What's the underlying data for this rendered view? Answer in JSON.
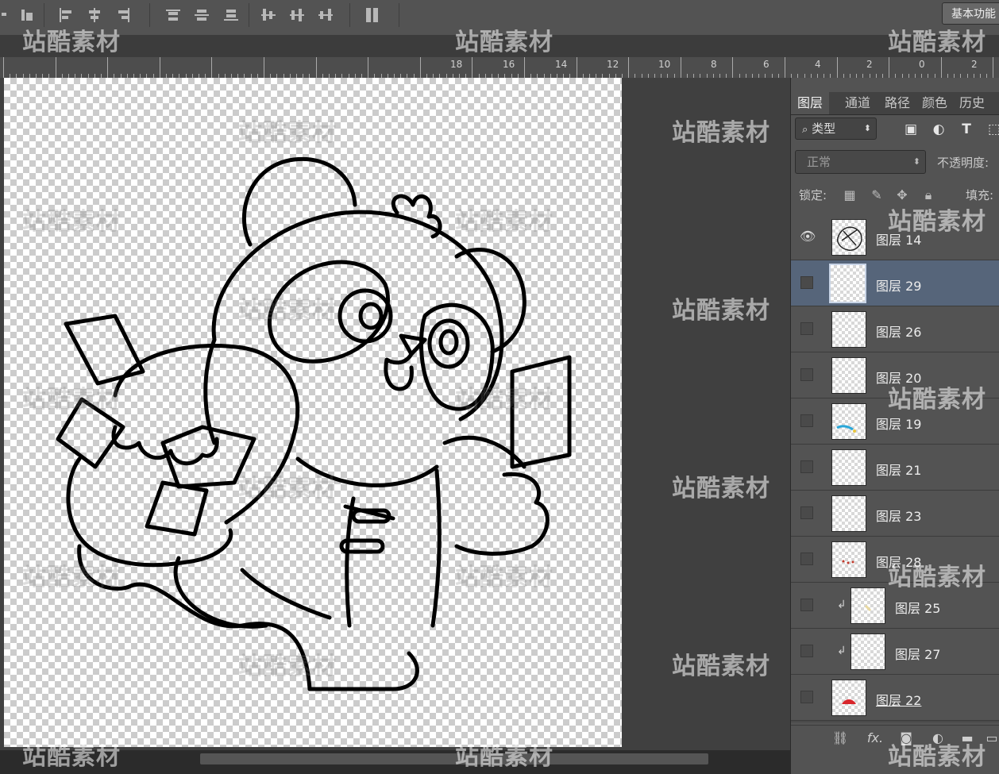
{
  "options_bar": {
    "workspace_button": "基本功能"
  },
  "ruler": {
    "labels": [
      "18",
      "16",
      "14",
      "12",
      "10",
      "8",
      "6",
      "4",
      "2",
      "0",
      "2"
    ]
  },
  "layers_panel": {
    "tabs": [
      "图层",
      "通道",
      "路径",
      "颜色",
      "历史"
    ],
    "filter_label": "类型",
    "blend_mode": "正常",
    "opacity_label": "不透明度:",
    "lock_label": "锁定:",
    "fill_label": "填充:",
    "layers": [
      {
        "name": "图层 14",
        "visible": true,
        "selected": false,
        "clipped": false
      },
      {
        "name": "图层 29",
        "visible": false,
        "selected": true,
        "clipped": false
      },
      {
        "name": "图层 26",
        "visible": false,
        "selected": false,
        "clipped": false
      },
      {
        "name": "图层 20",
        "visible": false,
        "selected": false,
        "clipped": false
      },
      {
        "name": "图层 19",
        "visible": false,
        "selected": false,
        "clipped": false
      },
      {
        "name": "图层 21",
        "visible": false,
        "selected": false,
        "clipped": false
      },
      {
        "name": "图层 23",
        "visible": false,
        "selected": false,
        "clipped": false
      },
      {
        "name": "图层 28",
        "visible": false,
        "selected": false,
        "clipped": false
      },
      {
        "name": "图层 25",
        "visible": false,
        "selected": false,
        "clipped": true
      },
      {
        "name": "图层 27",
        "visible": false,
        "selected": false,
        "clipped": true
      },
      {
        "name": "图层 22",
        "visible": false,
        "selected": false,
        "clipped": false
      }
    ],
    "footer_fx": "fx."
  },
  "watermark": "站酷素材",
  "icons": {
    "eye": "eye-icon",
    "search": "search-icon",
    "clip": "clip-arrow-icon"
  }
}
